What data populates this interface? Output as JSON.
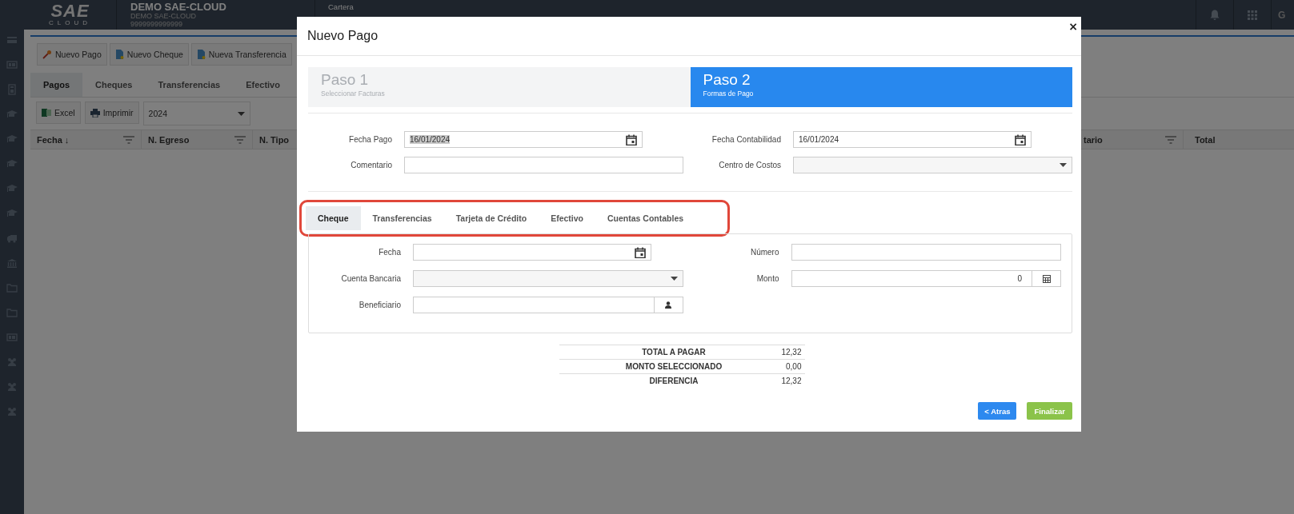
{
  "logo": {
    "name": "SAE",
    "tagline": "CLOUD"
  },
  "company": {
    "name": "DEMO SAE-CLOUD",
    "subtitle": "DEMO SAE-CLOUD",
    "id": "9999999999999"
  },
  "breadcrumb": {
    "module": "Cartera"
  },
  "user": "G",
  "toolbar": {
    "buttons": [
      "Nuevo Pago",
      "Nuevo Cheque",
      "Nueva Transferencia"
    ]
  },
  "tabs": [
    {
      "label": "Pagos",
      "selected": true
    },
    {
      "label": "Cheques",
      "selected": false
    },
    {
      "label": "Transferencias",
      "selected": false
    },
    {
      "label": "Efectivo",
      "selected": false
    }
  ],
  "actions": {
    "buttons": [
      "Excel",
      "Imprimir"
    ],
    "year": "2024"
  },
  "table": {
    "columns": [
      {
        "label": "Fecha ↓",
        "filter": true
      },
      {
        "label": "N. Egreso",
        "filter": true
      },
      {
        "label": "N. Tipo"
      }
    ],
    "right_columns": [
      {
        "label": "tario",
        "filter": true
      },
      {
        "label": "Total",
        "filter": false
      }
    ]
  },
  "modal": {
    "title": "Nuevo Pago",
    "close": "×",
    "steps": [
      {
        "title": "Paso 1",
        "subtitle": "Seleccionar Facturas",
        "selected": false
      },
      {
        "title": "Paso 2",
        "subtitle": "Formas de Pago",
        "selected": true
      }
    ],
    "fields": [
      {
        "label": "Fecha Pago",
        "kind": "date",
        "value": "16/01/2024",
        "highlighted": true
      },
      {
        "label": "Fecha Contabilidad",
        "kind": "date",
        "value": "16/01/2024",
        "highlighted": false
      },
      {
        "label": "Comentario",
        "kind": "text"
      },
      {
        "label": "Centro de Costos",
        "kind": "select"
      }
    ],
    "payment_tabs": [
      {
        "label": "Cheque",
        "selected": true
      },
      {
        "label": "Transferencias",
        "selected": false
      },
      {
        "label": "Tarjeta de Crédito",
        "selected": false
      },
      {
        "label": "Efectivo",
        "selected": false
      },
      {
        "label": "Cuentas Contables",
        "selected": false
      }
    ],
    "payment_fields": [
      {
        "label": "Fecha",
        "kind": "date"
      },
      {
        "label": "Número",
        "kind": "text"
      },
      {
        "label": "Cuenta Bancaria",
        "kind": "select"
      },
      {
        "label": "Monto",
        "kind": "amount",
        "value": "0"
      },
      {
        "label": "Beneficiario",
        "kind": "person"
      }
    ],
    "summary": [
      {
        "label": "TOTAL A PAGAR",
        "value": "12,32"
      },
      {
        "label": "MONTO SELECCIONADO",
        "value": "0,00"
      },
      {
        "label": "DIFERENCIA",
        "value": "12,32"
      }
    ],
    "buttons": [
      {
        "label": "< Atras",
        "kind": "back"
      },
      {
        "label": "Finalizar",
        "kind": "finish"
      }
    ]
  }
}
